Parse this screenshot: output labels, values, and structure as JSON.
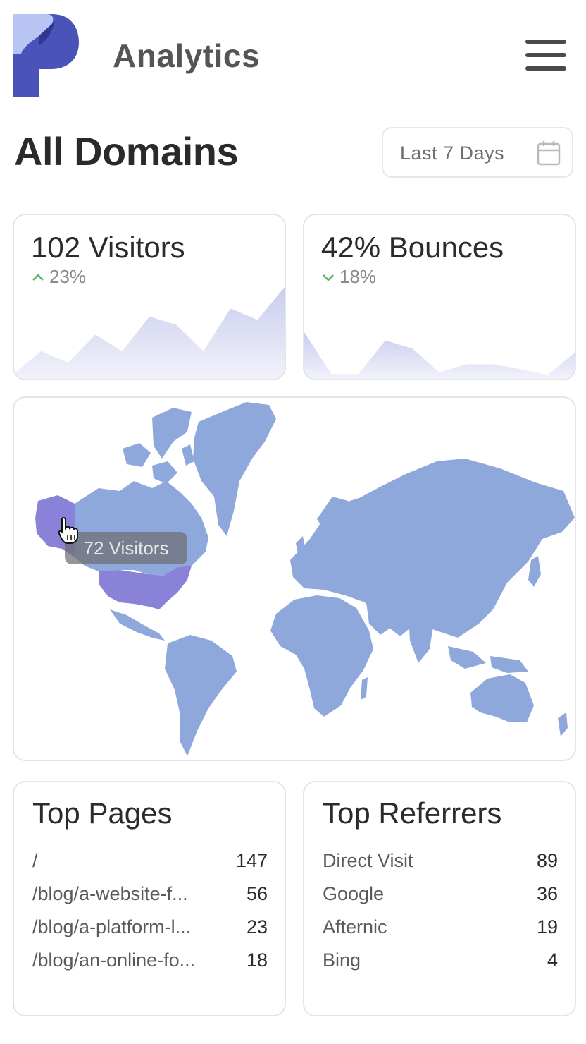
{
  "header": {
    "app_title": "Analytics",
    "logo_icon": "p-logo-icon",
    "menu_icon": "hamburger-menu-icon"
  },
  "page": {
    "title": "All Domains",
    "date_range": "Last 7 Days",
    "date_icon": "calendar-icon"
  },
  "stats": {
    "visitors": {
      "title": "102 Visitors",
      "delta": "23%",
      "delta_direction": "up",
      "trend": [
        5,
        32,
        18,
        52,
        32,
        74,
        64,
        32,
        84,
        70,
        110
      ],
      "fill_color": "#c9cdee"
    },
    "bounces": {
      "title": "42% Bounces",
      "delta": "18%",
      "delta_direction": "down",
      "trend": [
        55,
        4,
        4,
        45,
        35,
        6,
        16,
        16,
        10,
        3,
        30
      ],
      "fill_color": "#c9cdee"
    }
  },
  "map": {
    "tooltip": "72 Visitors",
    "highlighted_region": "United States",
    "land_color": "#8fa8dc",
    "highlight_color": "#8a82d8",
    "cursor_icon": "hand-pointer-icon"
  },
  "top_pages": {
    "title": "Top Pages",
    "rows": [
      {
        "label": "/",
        "value": "147"
      },
      {
        "label": "/blog/a-website-f...",
        "value": "56"
      },
      {
        "label": "/blog/a-platform-l...",
        "value": "23"
      },
      {
        "label": "/blog/an-online-fo...",
        "value": "18"
      }
    ]
  },
  "top_referrers": {
    "title": "Top Referrers",
    "rows": [
      {
        "label": "Direct Visit",
        "value": "89"
      },
      {
        "label": "Google",
        "value": "36"
      },
      {
        "label": "Afternic",
        "value": "19"
      },
      {
        "label": "Bing",
        "value": "4"
      }
    ]
  }
}
